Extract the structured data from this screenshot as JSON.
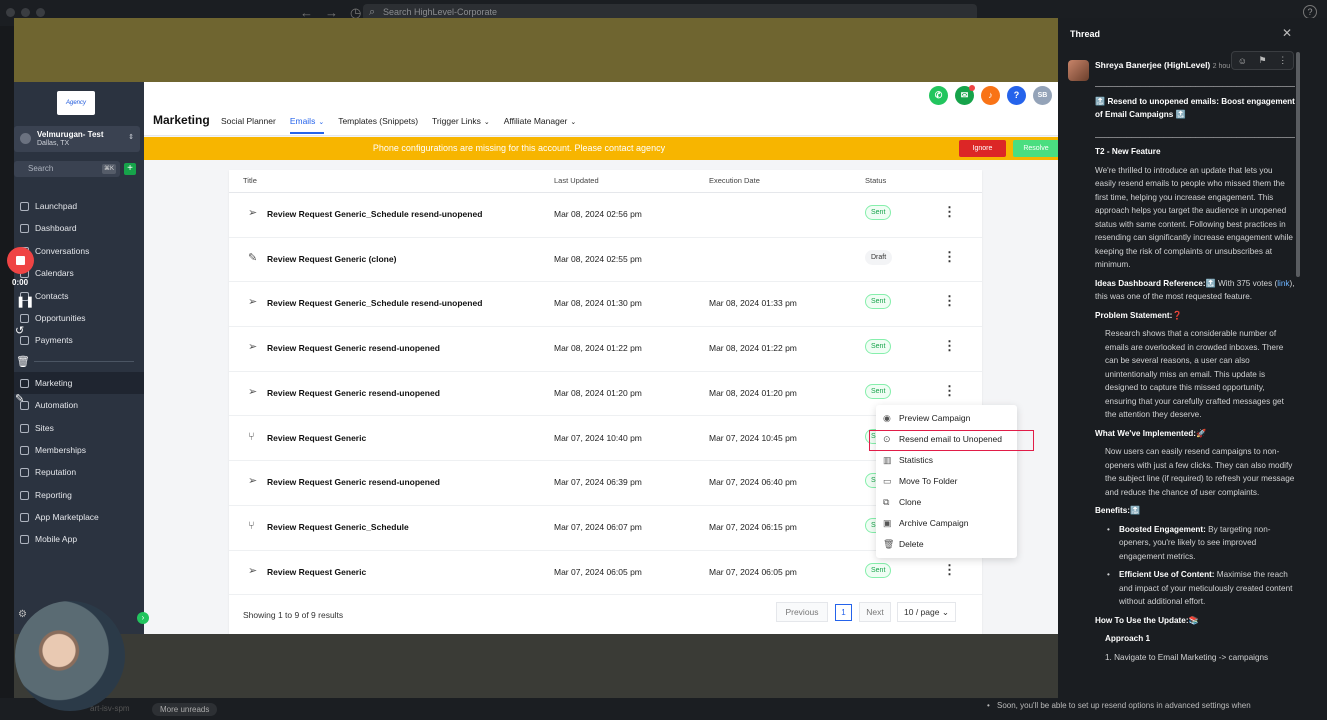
{
  "topbar": {
    "search_placeholder": "Search HighLevel-Corporate",
    "help": "?"
  },
  "sidebar": {
    "logo": "Agency",
    "account_name": "Velmurugan- Test",
    "account_location": "Dallas, TX",
    "search_placeholder": "Search",
    "search_kbd": "⌘K",
    "items": [
      "Launchpad",
      "Dashboard",
      "Conversations",
      "Calendars",
      "Contacts",
      "Opportunities",
      "Payments",
      "Marketing",
      "Automation",
      "Sites",
      "Memberships",
      "Reputation",
      "Reporting",
      "App Marketplace",
      "Mobile App"
    ]
  },
  "header": {
    "title": "Marketing",
    "tabs": [
      {
        "label": "Social Planner",
        "caret": ""
      },
      {
        "label": "Emails",
        "caret": "⌄"
      },
      {
        "label": "Templates (Snippets)",
        "caret": ""
      },
      {
        "label": "Trigger Links",
        "caret": "⌄"
      },
      {
        "label": "Affiliate Manager",
        "caret": "⌄"
      }
    ],
    "avatar_initials": "SB"
  },
  "banner": {
    "message": "Phone configurations are missing for this account. Please contact agency",
    "ignore_label": "Ignore",
    "resolve_label": "Resolve"
  },
  "table": {
    "columns": [
      "Title",
      "Last Updated",
      "Execution Date",
      "Status"
    ],
    "rows": [
      {
        "title": "Review Request Generic_Schedule resend-unopened",
        "updated": "Mar 08, 2024 02:56 pm",
        "executed": "",
        "status": "Sent"
      },
      {
        "title": "Review Request Generic (clone)",
        "updated": "Mar 08, 2024 02:55 pm",
        "executed": "",
        "status": "Draft"
      },
      {
        "title": "Review Request Generic_Schedule resend-unopened",
        "updated": "Mar 08, 2024 01:30 pm",
        "executed": "Mar 08, 2024 01:33 pm",
        "status": "Sent"
      },
      {
        "title": "Review Request Generic resend-unopened",
        "updated": "Mar 08, 2024 01:22 pm",
        "executed": "Mar 08, 2024 01:22 pm",
        "status": "Sent"
      },
      {
        "title": "Review Request Generic resend-unopened",
        "updated": "Mar 08, 2024 01:20 pm",
        "executed": "Mar 08, 2024 01:20 pm",
        "status": "Sent"
      },
      {
        "title": "Review Request Generic",
        "updated": "Mar 07, 2024 10:40 pm",
        "executed": "Mar 07, 2024 10:45 pm",
        "status": "Sent"
      },
      {
        "title": "Review Request Generic resend-unopened",
        "updated": "Mar 07, 2024 06:39 pm",
        "executed": "Mar 07, 2024 06:40 pm",
        "status": "Sent"
      },
      {
        "title": "Review Request Generic_Schedule",
        "updated": "Mar 07, 2024 06:07 pm",
        "executed": "Mar 07, 2024 06:15 pm",
        "status": "Sent"
      },
      {
        "title": "Review Request Generic",
        "updated": "Mar 07, 2024 06:05 pm",
        "executed": "Mar 07, 2024 06:05 pm",
        "status": "Sent"
      }
    ],
    "showing": "Showing 1 to 9 of 9 results",
    "prev": "Previous",
    "page": "1",
    "next": "Next",
    "page_size": "10 / page"
  },
  "context_menu": {
    "items": [
      "Preview Campaign",
      "Resend email to Unopened",
      "Statistics",
      "Move To Folder",
      "Clone",
      "Archive Campaign",
      "Delete"
    ]
  },
  "recorder": {
    "time": "0:00"
  },
  "bottom": {
    "more_unreads": "More unreads",
    "ghost_text": "art-isv-spm",
    "thread_snippet": "Soon, you'll be able to set up resend options in advanced settings when"
  },
  "thread": {
    "title": "Thread",
    "author": "Shreya Banerjee (HighLevel)",
    "when": "2 hou",
    "rule": "________________________________________________________",
    "headline": "🔝 Resend to unopened emails: Boost engagement of Email Campaigns 🔝",
    "feature_tag": "T2 - New Feature",
    "intro": "We're thrilled to introduce an update that lets you easily resend emails to people who missed them the first time, helping you increase engagement. This approach helps you target the audience in unopened status with same content. Following best practices in resending can significantly increase engagement while keeping the risk of complaints or unsubscribes at minimum.",
    "ideas_label": "Ideas Dashboard Reference:🔝",
    "ideas_text_a": " With 375 votes (",
    "ideas_link": "link",
    "ideas_text_b": "), this was one of the most requested feature.",
    "problem_label": "Problem Statement:❓",
    "problem_text": "Research shows that a considerable number of emails are overlooked in crowded inboxes. There can be several reasons, a user can also unintentionally miss an email. This update is designed to capture this missed opportunity, ensuring that your carefully crafted messages get the attention they deserve.",
    "implemented_label": "What We've Implemented:🚀",
    "implemented_text": "Now users can easily resend campaigns to non-openers with just a few clicks. They can also modify the subject line (if required) to refresh your message and reduce the chance of user complaints.",
    "benefits_label": "Benefits:🔝",
    "benefit1_label": "Boosted Engagement:",
    "benefit1_text": " By targeting non-openers, you're likely to see improved engagement metrics.",
    "benefit2_label": "Efficient Use of Content:",
    "benefit2_text": " Maximise the reach and impact of your meticulously created content without additional effort.",
    "howto_label": "How To Use the Update:📚",
    "approach_label": "Approach 1",
    "step1": "1.  Navigate to Email Marketing -> campaigns"
  },
  "colors": {
    "accent": "#2563eb",
    "banner": "#f7b500",
    "sent": "#16a34a",
    "danger": "#dc2626",
    "highlight": "#e11d48"
  }
}
